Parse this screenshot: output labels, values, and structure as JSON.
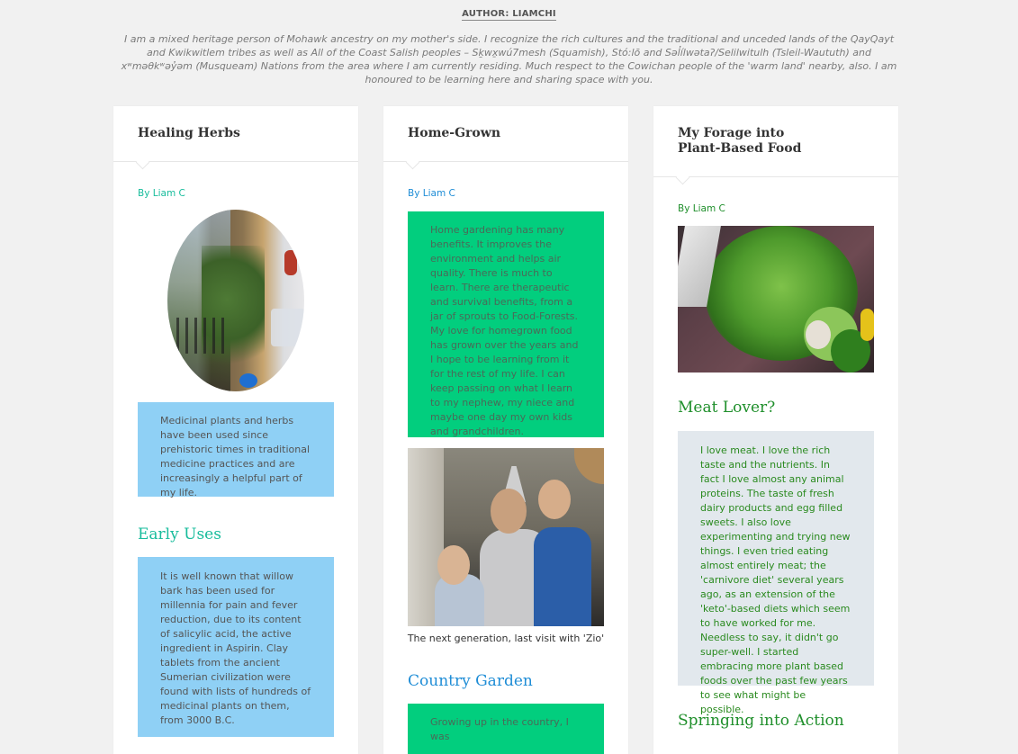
{
  "header": {
    "author_label": "AUTHOR: LIAMCHI",
    "bio": "I am a mixed heritage person of Mohawk ancestry on my mother's side. I recognize the rich cultures and the traditional and unceded lands of the QayQayt and Kwikwitlem tribes as well as All of the Coast Salish peoples – Sḵwx̱wú7mesh (Squamish), Stó:lō and Səl̓ílwətaʔ/Selilwitulh (Tsleil-Waututh) and xʷməθkʷəy̓əm (Musqueam) Nations from the area where I am currently residing. Much respect to the Cowichan people of the 'warm land' nearby, also. I am honoured to be learning here and sharing space with you."
  },
  "cards": [
    {
      "title": "Healing Herbs",
      "byline": "By Liam C",
      "accent": "#18bc9c",
      "image": "herb garden on balcony",
      "intro_block": "Medicinal plants and herbs have been used since prehistoric times in traditional medicine practices and are increasingly a helpful part of my life.",
      "section_title": "Early Uses",
      "section_block": "It is well known that willow bark has been used for millennia for pain and fever reduction, due to its content of salicylic acid, the active ingredient in Aspirin. Clay tablets from the ancient Sumerian civilization were found with lists of hundreds of medicinal plants on them, from 3000 B.C."
    },
    {
      "title": "Home-Grown",
      "byline": "By Liam C",
      "accent": "#1f8dd6",
      "intro_block": "Home gardening has many benefits. It improves the environment and helps air quality. There is much to learn. There are therapeutic and survival benefits, from a jar of sprouts to Food-Forests. My love for homegrown food has grown over the years and I hope to be learning from it for the rest of my life. I can keep passing on what I learn to my nephew, my niece and maybe one day my own kids and grandchildren.",
      "image": "family photo on couch",
      "caption": "The next generation, last visit with 'Zio'",
      "section_title": "Country Garden",
      "section_block": "Growing up in the country, I was"
    },
    {
      "title": "My Forage into Plant-Based Food",
      "byline": "By Liam C",
      "accent": "#1f8f2b",
      "image": "fresh herbs and vegetables",
      "section_title": "Meat Lover?",
      "section_block": "I love meat. I love the rich taste and the nutrients. In fact I love almost any animal proteins. The taste of fresh dairy products and egg filled sweets. I also love experimenting and trying new things. I even tried eating almost entirely meat; the 'carnivore diet' several years ago, as an extension of the 'keto'-based diets which seem to have worked for me. Needless to say, it didn't go super-well. I started embracing more plant based foods over the past few years to see what might be possible.",
      "section2_title": "Springing into Action"
    }
  ]
}
